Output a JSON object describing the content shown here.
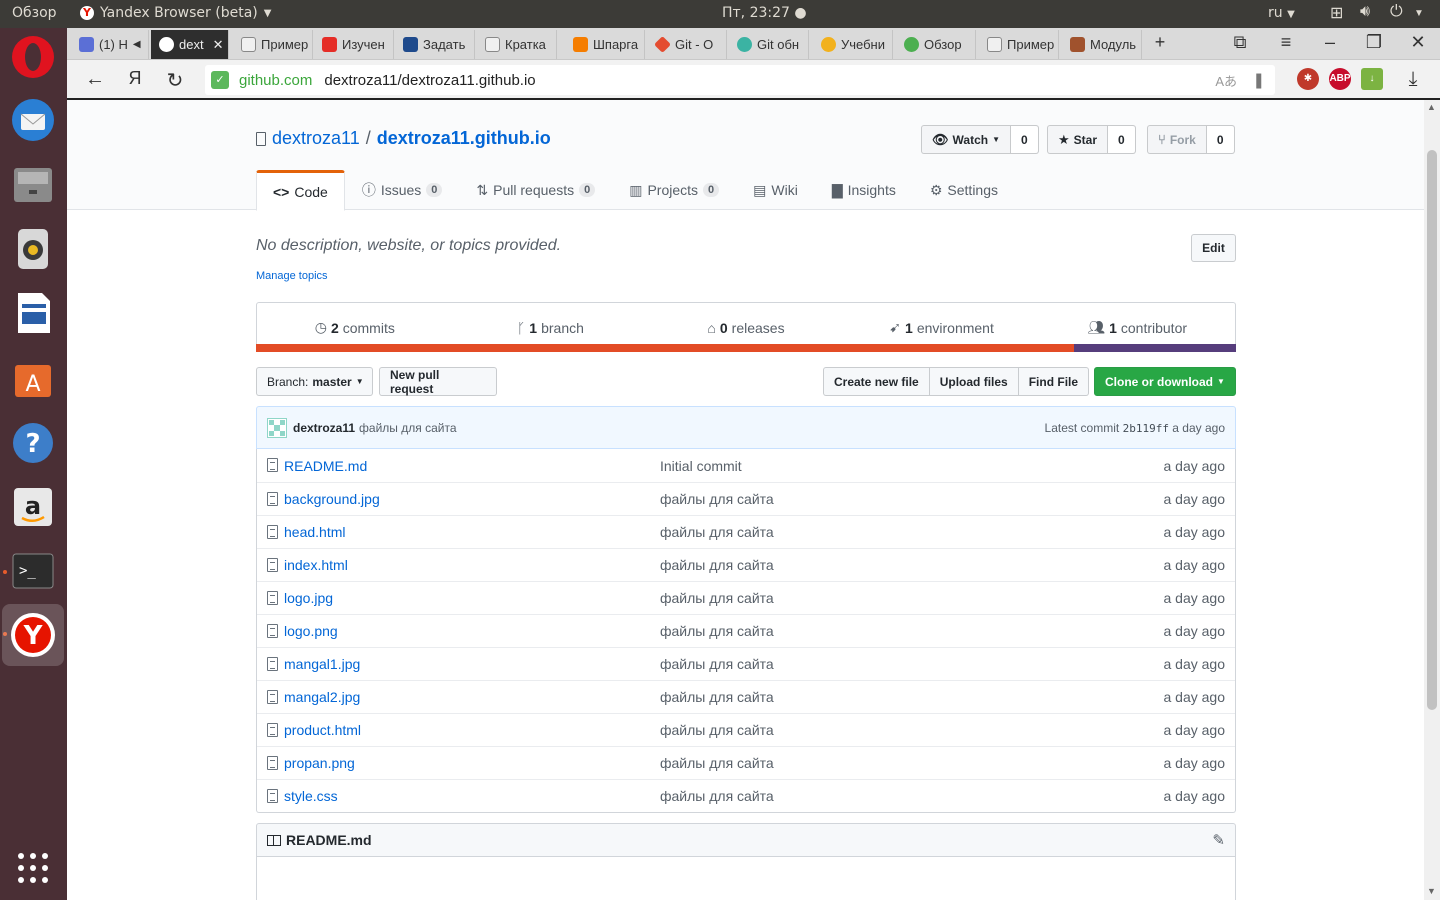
{
  "os_panel": {
    "activities": "Обзор",
    "app_title": "Yandex Browser (beta)",
    "clock": "Пт, 23:27 ●",
    "language": "ru"
  },
  "tabs": [
    {
      "label": "(1) Н",
      "color": "#5b6fd6"
    },
    {
      "label": "dext",
      "color": "#ffffff"
    },
    {
      "label": "Пример",
      "color": "#f0f0f0"
    },
    {
      "label": "Изучен",
      "color": "#e52d27"
    },
    {
      "label": "Задать",
      "color": "#1e4a8c"
    },
    {
      "label": "Кратка",
      "color": "#f0f0f0"
    },
    {
      "label": "Шпарга",
      "color": "#f57d00"
    },
    {
      "label": "Git - О",
      "color": "#e44c30"
    },
    {
      "label": "Git обн",
      "color": "#3bb3a3"
    },
    {
      "label": "Учебни",
      "color": "#f2b11d"
    },
    {
      "label": "Обзор",
      "color": "#4caf50"
    },
    {
      "label": "Пример",
      "color": "#f0f0f0"
    },
    {
      "label": "Модуль",
      "color": "#a0522d"
    }
  ],
  "address": {
    "domain": "github.com",
    "path": "dextroza11/dextroza11.github.io"
  },
  "repo": {
    "owner": "dextroza11",
    "separator": "/",
    "name": "dextroza11.github.io",
    "watch_label": "Watch",
    "watch_count": "0",
    "star_label": "Star",
    "star_count": "0",
    "fork_label": "Fork",
    "fork_count": "0"
  },
  "reponav": [
    {
      "label": "Code",
      "counter": ""
    },
    {
      "label": "Issues",
      "counter": "0"
    },
    {
      "label": "Pull requests",
      "counter": "0"
    },
    {
      "label": "Projects",
      "counter": "0"
    },
    {
      "label": "Wiki",
      "counter": ""
    },
    {
      "label": "Insights",
      "counter": ""
    },
    {
      "label": "Settings",
      "counter": ""
    }
  ],
  "description": "No description, website, or topics provided.",
  "manage_topics": "Manage topics",
  "edit_label": "Edit",
  "summary": [
    {
      "count": "2",
      "label": "commits"
    },
    {
      "count": "1",
      "label": "branch"
    },
    {
      "count": "0",
      "label": "releases"
    },
    {
      "count": "1",
      "label": "environment"
    },
    {
      "count": "1",
      "label": "contributor"
    }
  ],
  "language_colors": [
    "#e34c26",
    "#563d7c"
  ],
  "language_share": [
    0.835,
    0.165
  ],
  "branch": {
    "prefix": "Branch:",
    "name": "master"
  },
  "new_pull_request": "New pull request",
  "file_buttons": [
    "Create new file",
    "Upload files",
    "Find File"
  ],
  "clone_label": "Clone or download",
  "commit": {
    "author": "dextroza11",
    "message": "файлы для сайта",
    "latest_prefix": "Latest commit",
    "sha": "2b119ff",
    "age": "a day ago"
  },
  "files": [
    {
      "name": "README.md",
      "message": "Initial commit",
      "age": "a day ago"
    },
    {
      "name": "background.jpg",
      "message": "файлы для сайта",
      "age": "a day ago"
    },
    {
      "name": "head.html",
      "message": "файлы для сайта",
      "age": "a day ago"
    },
    {
      "name": "index.html",
      "message": "файлы для сайта",
      "age": "a day ago"
    },
    {
      "name": "logo.jpg",
      "message": "файлы для сайта",
      "age": "a day ago"
    },
    {
      "name": "logo.png",
      "message": "файлы для сайта",
      "age": "a day ago"
    },
    {
      "name": "mangal1.jpg",
      "message": "файлы для сайта",
      "age": "a day ago"
    },
    {
      "name": "mangal2.jpg",
      "message": "файлы для сайта",
      "age": "a day ago"
    },
    {
      "name": "product.html",
      "message": "файлы для сайта",
      "age": "a day ago"
    },
    {
      "name": "propan.png",
      "message": "файлы для сайта",
      "age": "a day ago"
    },
    {
      "name": "style.css",
      "message": "файлы для сайта",
      "age": "a day ago"
    }
  ],
  "readme_title": "README.md",
  "extensions": {
    "abp": "ABP"
  }
}
